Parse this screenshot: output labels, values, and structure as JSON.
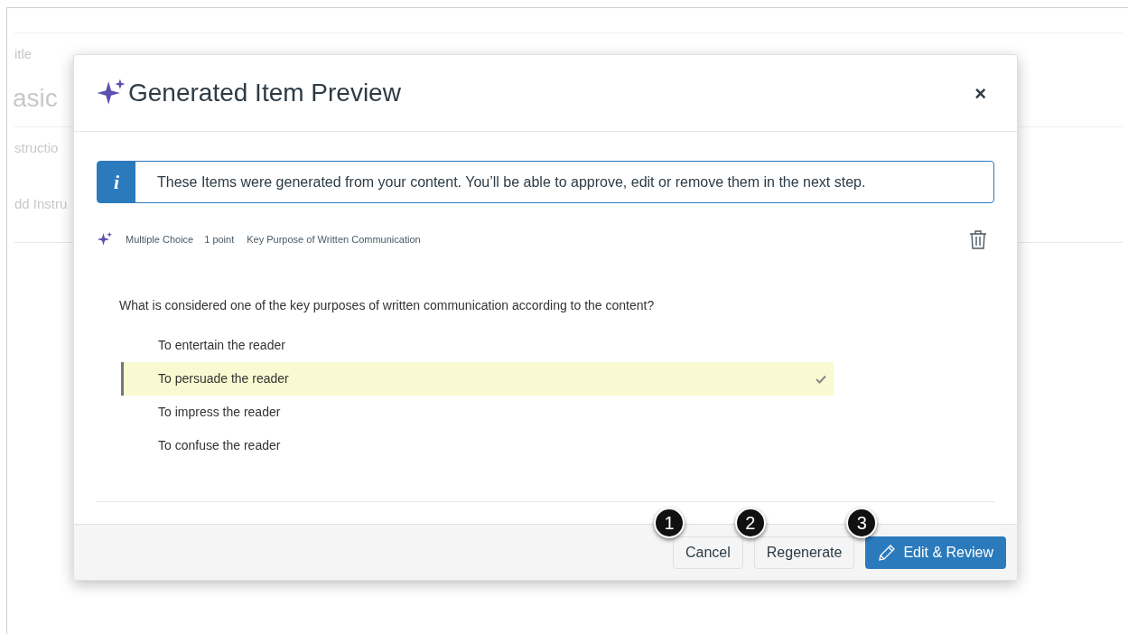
{
  "background_page": {
    "title_label": "itle",
    "title_value": "asic",
    "instructions_label": "structio",
    "instructions_field": "dd Instru"
  },
  "dialog": {
    "title": "Generated Item Preview",
    "close": "×",
    "info": {
      "icon_text": "i",
      "message": "These Items were generated from your content. You’ll be able to approve, edit or remove them in the next step."
    },
    "item": {
      "type": "Multiple Choice",
      "points": "1 point",
      "topic": "Key Purpose of Written Communication",
      "question": "What is considered one of the key purposes of written communication according to the content?",
      "options": [
        {
          "text": "To entertain the reader",
          "correct": false
        },
        {
          "text": "To persuade the reader",
          "correct": true
        },
        {
          "text": "To impress the reader",
          "correct": false
        },
        {
          "text": "To confuse the reader",
          "correct": false
        }
      ]
    },
    "buttons": [
      {
        "label": "Cancel",
        "kind": "secondary",
        "callout": "1"
      },
      {
        "label": "Regenerate",
        "kind": "secondary",
        "callout": "2"
      },
      {
        "label": "Edit & Review",
        "kind": "primary",
        "callout": "3"
      }
    ]
  }
}
